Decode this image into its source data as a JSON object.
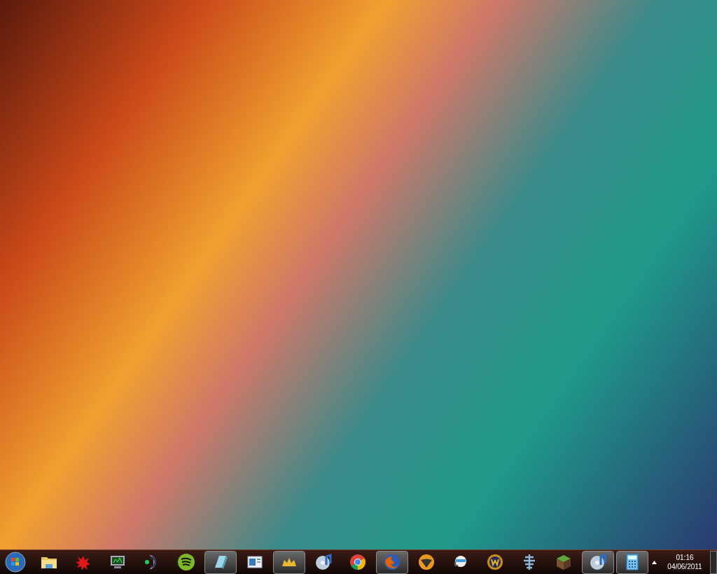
{
  "taskbar": {
    "buttons": [
      {
        "kind": "folder",
        "active": false
      },
      {
        "kind": "splat",
        "active": false
      },
      {
        "kind": "monitor",
        "active": false
      },
      {
        "kind": "voice",
        "active": false
      },
      {
        "kind": "music-stream",
        "active": false
      },
      {
        "kind": "notepad",
        "active": true
      },
      {
        "kind": "window",
        "active": false
      },
      {
        "kind": "crown",
        "active": true
      },
      {
        "kind": "music-disc",
        "active": false
      },
      {
        "kind": "chrome",
        "active": false
      },
      {
        "kind": "firefox",
        "active": true
      },
      {
        "kind": "orange-orb",
        "active": false
      },
      {
        "kind": "headset",
        "active": false
      },
      {
        "kind": "gold-coin",
        "active": false
      },
      {
        "kind": "emblem",
        "active": false
      },
      {
        "kind": "grass-block",
        "active": false
      },
      {
        "kind": "music-disc",
        "active": true
      },
      {
        "kind": "calculator",
        "active": true
      }
    ],
    "clock": {
      "time": "01:16",
      "date": "04/06/2011"
    }
  }
}
